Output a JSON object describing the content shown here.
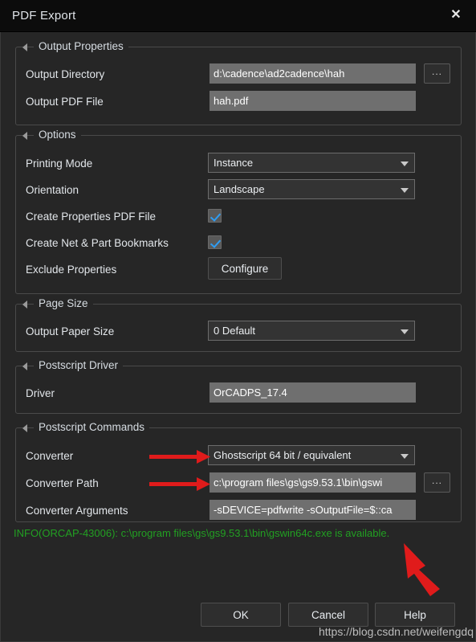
{
  "window": {
    "title": "PDF Export",
    "close_icon": "close-icon"
  },
  "groups": {
    "output_properties": {
      "title": "Output Properties",
      "rows": [
        {
          "label": "Output Directory",
          "value": "d:\\cadence\\ad2cadence\\hah",
          "browse_label": "..."
        },
        {
          "label": "Output PDF File",
          "value": "hah.pdf"
        }
      ]
    },
    "options": {
      "title": "Options",
      "printing_mode": {
        "label": "Printing Mode",
        "value": "Instance"
      },
      "orientation": {
        "label": "Orientation",
        "value": "Landscape"
      },
      "create_properties_pdf": {
        "label": "Create Properties PDF File",
        "checked": true
      },
      "create_bookmarks": {
        "label": "Create Net & Part Bookmarks",
        "checked": true
      },
      "exclude_properties": {
        "label": "Exclude Properties",
        "button_label": "Configure"
      }
    },
    "page_size": {
      "title": "Page Size",
      "output_paper_size": {
        "label": "Output Paper Size",
        "value": "0 Default"
      }
    },
    "postscript_driver": {
      "title": "Postscript Driver",
      "driver": {
        "label": "Driver",
        "value": "OrCADPS_17.4"
      }
    },
    "postscript_commands": {
      "title": "Postscript Commands",
      "converter": {
        "label": "Converter",
        "value": "Ghostscript 64 bit / equivalent"
      },
      "converter_path": {
        "label": "Converter Path",
        "value": "c:\\program files\\gs\\gs9.53.1\\bin\\gswi",
        "browse_label": "..."
      },
      "converter_arguments": {
        "label": "Converter Arguments",
        "value": "-sDEVICE=pdfwrite -sOutputFile=$::ca"
      }
    }
  },
  "info_message": "INFO(ORCAP-43006): c:\\program files\\gs\\gs9.53.1\\bin\\gswin64c.exe is available.",
  "footer": {
    "ok_label": "OK",
    "cancel_label": "Cancel",
    "help_label": "Help"
  },
  "watermark": "https://blog.csdn.net/weifengdq",
  "colors": {
    "dialog_bg": "#262626",
    "titlebar_bg": "#0c0c0c",
    "field_bg": "#6f6f6f",
    "dropdown_bg": "#333333",
    "accent_check": "#2e9df4",
    "info_green": "#22a022",
    "annotation_red": "#e01b1b"
  }
}
